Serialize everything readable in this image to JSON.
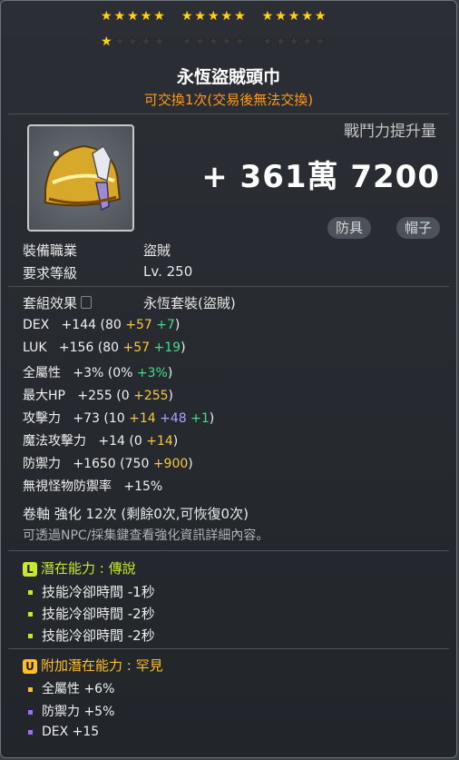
{
  "stars": {
    "row1": [
      5,
      5,
      5
    ],
    "row2_filled": 1,
    "row2_total": 15
  },
  "item": {
    "name": "永恆盜賊頭巾",
    "trade": "可交換1次(交易後無法交換)",
    "cp_label": "戰鬥力提升量",
    "cp_value": "+ 361萬 7200",
    "tags": [
      "防具",
      "帽子"
    ]
  },
  "req": [
    {
      "label": "裝備職業",
      "value": "盜賊"
    },
    {
      "label": "要求等級",
      "value": "Lv. 250"
    }
  ],
  "set": {
    "label": "套組效果",
    "value": "永恆套裝(盜賊)"
  },
  "stats": [
    {
      "name": "DEX",
      "base": "+144",
      "detail": "(80",
      "b1": "+57",
      "b2": "+7",
      "end": ")"
    },
    {
      "name": "LUK",
      "base": "+156",
      "detail": "(80",
      "b1": "+57",
      "b2": "+19",
      "end": ")"
    },
    {
      "name": "全屬性",
      "base": "+3%",
      "detail": "(0%",
      "b1": "",
      "b2": "+3%",
      "end": ")"
    },
    {
      "name": "最大HP",
      "base": "+255",
      "detail": "(0",
      "b1": "+255",
      "b2": "",
      "end": ")"
    },
    {
      "name": "攻擊力",
      "base": "+73",
      "detail": "(10",
      "b1": "+14",
      "b2": "+48",
      "b3": "+1",
      "end": ")"
    },
    {
      "name": "魔法攻擊力",
      "base": "+14",
      "detail": "(0",
      "b1": "+14",
      "b2": "",
      "end": ")"
    },
    {
      "name": "防禦力",
      "base": "+1650",
      "detail": "(750",
      "b1": "+900",
      "b2": "",
      "end": ")"
    },
    {
      "name": "無視怪物防禦率",
      "base": "+15%",
      "detail": "",
      "b1": "",
      "b2": "",
      "end": ""
    }
  ],
  "scroll": "卷軸 強化 12次 (剩餘0次,可恢復0次)",
  "note": "可透過NPC/採集鍵查看強化資訊詳細內容。",
  "potential": {
    "badge": "L",
    "title": "潛在能力 : 傳說",
    "lines": [
      "技能冷卻時間 -1秒",
      "技能冷卻時間 -2秒",
      "技能冷卻時間 -2秒"
    ]
  },
  "additional": {
    "badge": "U",
    "title": "附加潛在能力 : 罕見",
    "lines": [
      "全屬性 +6%",
      "防禦力 +5%",
      "DEX +15"
    ]
  }
}
